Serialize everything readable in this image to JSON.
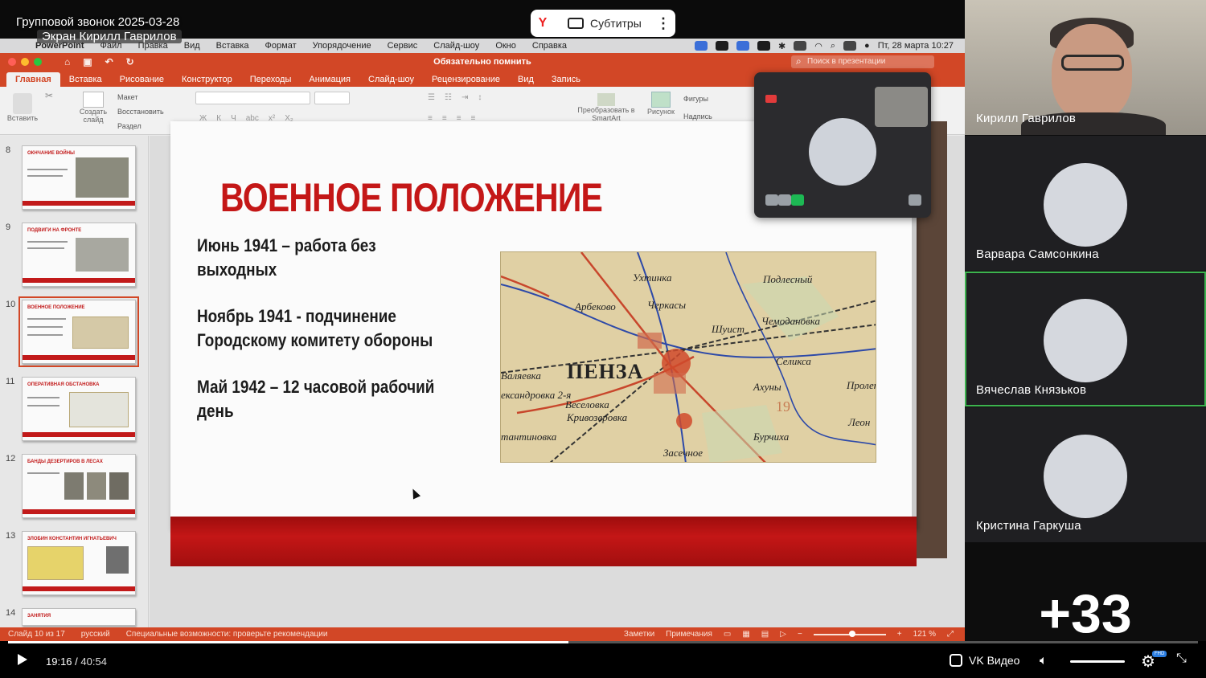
{
  "call": {
    "title": "Групповой звонок 2025-03-28",
    "presenter_label": "Экран Кирилл Гаврилов",
    "subtitles_label": "Субтитры"
  },
  "mac_menu": {
    "items": [
      "PowerPoint",
      "Файл",
      "Правка",
      "Вид",
      "Вставка",
      "Формат",
      "Упорядочение",
      "Сервис",
      "Слайд-шоу",
      "Окно",
      "Справка"
    ],
    "datetime": "Пт, 28 марта  10:27"
  },
  "powerpoint": {
    "document_title": "Обязательно помнить",
    "search_placeholder": "Поиск в презентации",
    "tabs": [
      "Главная",
      "Вставка",
      "Рисование",
      "Конструктор",
      "Переходы",
      "Анимация",
      "Слайд-шоу",
      "Рецензирование",
      "Вид",
      "Запись"
    ],
    "ribbon": {
      "paste": "Вставить",
      "new_slide": "Создать слайд",
      "layout": "Макет",
      "reset": "Восстановить",
      "section": "Раздел",
      "smartart": "Преобразовать в SmartArt",
      "picture": "Рисунок",
      "shapes": "Фигуры",
      "textbox": "Надпись"
    },
    "thumbnails": [
      {
        "num": "8",
        "title": "ОКНЧАНИЕ ВОЙНЫ"
      },
      {
        "num": "9",
        "title": "ПОДВИГИ НА ФРОНТЕ"
      },
      {
        "num": "10",
        "title": "ВОЕННОЕ ПОЛОЖЕНИЕ"
      },
      {
        "num": "11",
        "title": "ОПЕРАТИВНАЯ ОБСТАНОВКА"
      },
      {
        "num": "12",
        "title": "БАНДЫ ДЕЗЕРТИРОВ В ЛЕСАХ"
      },
      {
        "num": "13",
        "title": "ЗЛОБИН КОНСТАНТИН ИГНАТЬЕВИЧ"
      },
      {
        "num": "14",
        "title": "ЗАНЯТИЯ"
      }
    ],
    "slide": {
      "title": "ВОЕННОЕ ПОЛОЖЕНИЕ",
      "bullets": [
        "Июнь 1941 – работа без выходных",
        "Ноябрь 1941  - подчинение\nГородскому комитету обороны",
        "Май 1942 – 12 часовой рабочий\nдень"
      ],
      "map_labels": {
        "city": "ПЕНЗА",
        "l1": "Ухтинка",
        "l2": "Арбеково",
        "l3": "Черкасы",
        "l4": "Подлесный",
        "l5": "Шуист",
        "l6": "Чемодановка",
        "l7": "Селикса",
        "l8": "Ахуны",
        "l9": "Валяевка",
        "l10": "ександровка 2-я",
        "l11": "Веселовка",
        "l12": "Кривозеровка",
        "l13": "Бурчиха",
        "l14": "тантиновка",
        "l15": "Засечное",
        "l16": "Леон",
        "l17": "Пролет",
        "l18": "19"
      }
    },
    "status": {
      "slide_of": "Слайд 10 из 17",
      "language": "русский",
      "accessibility": "Специальные возможности: проверьте рекомендации",
      "notes": "Заметки",
      "comments": "Примечания",
      "zoom": "121 %"
    }
  },
  "participants": [
    {
      "name": "Кирилл Гаврилов",
      "video": true,
      "active": true
    },
    {
      "name": "Варвара Самсонкина",
      "video": false,
      "active": false
    },
    {
      "name": "Вячеслав Князьков",
      "video": false,
      "active": true
    },
    {
      "name": "Кристина Гаркуша",
      "video": false,
      "active": false
    }
  ],
  "more_count": "+33",
  "player": {
    "current": "19:16",
    "duration": "40:54",
    "progress": 0.471,
    "brand": "VK Видео",
    "quality_badge": "FHD"
  }
}
